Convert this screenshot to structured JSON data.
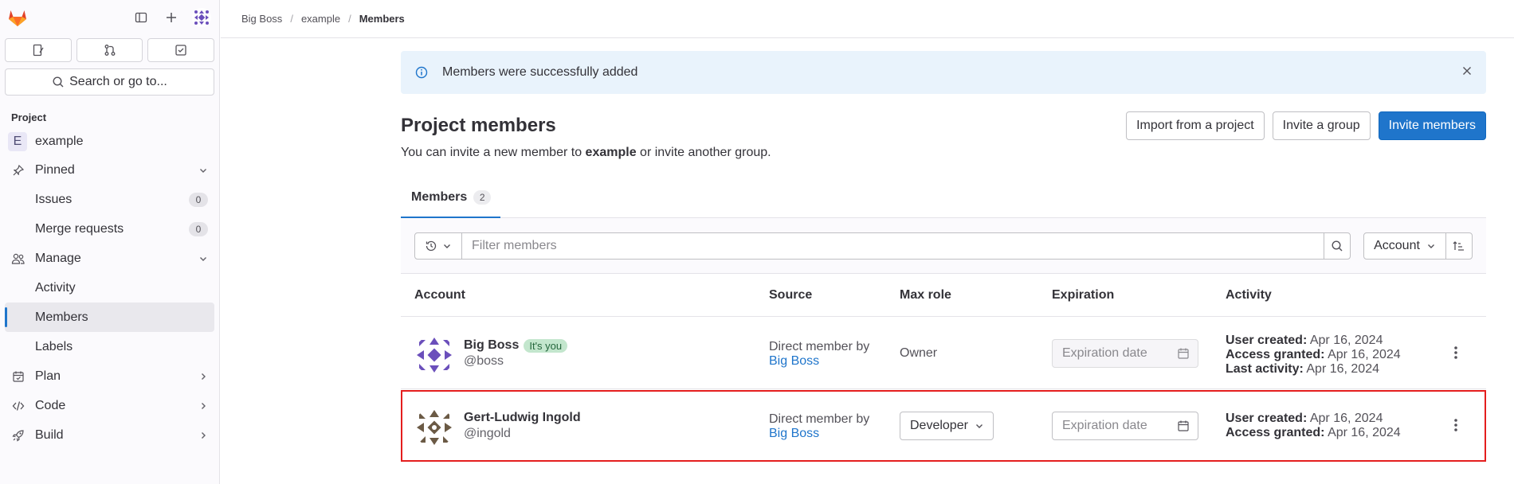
{
  "sidebar": {
    "search_label": "Search or go to...",
    "section_label": "Project",
    "project": {
      "initial": "E",
      "name": "example"
    },
    "pinned": {
      "label": "Pinned",
      "items": [
        {
          "label": "Issues",
          "count": "0"
        },
        {
          "label": "Merge requests",
          "count": "0"
        }
      ]
    },
    "manage": {
      "label": "Manage",
      "items": [
        {
          "label": "Activity"
        },
        {
          "label": "Members"
        },
        {
          "label": "Labels"
        }
      ]
    },
    "plan": "Plan",
    "code": "Code",
    "build": "Build"
  },
  "breadcrumb": [
    "Big Boss",
    "example",
    "Members"
  ],
  "alert": {
    "message": "Members were successfully added"
  },
  "page": {
    "title": "Project members",
    "subtitle_pre": "You can invite a new member to ",
    "subtitle_bold": "example",
    "subtitle_post": " or invite another group.",
    "buttons": {
      "import": "Import from a project",
      "invite_group": "Invite a group",
      "invite_members": "Invite members"
    }
  },
  "tabs": [
    {
      "label": "Members",
      "count": "2"
    }
  ],
  "filter": {
    "placeholder": "Filter members",
    "sort_label": "Account"
  },
  "table": {
    "headers": [
      "Account",
      "Source",
      "Max role",
      "Expiration",
      "Activity"
    ],
    "rows": [
      {
        "name": "Big Boss",
        "badge": "It's you",
        "handle": "@boss",
        "source_text": "Direct member by",
        "source_link": "Big Boss",
        "role": "Owner",
        "expiration_placeholder": "Expiration date",
        "activity": [
          {
            "label": "User created:",
            "value": "Apr 16, 2024"
          },
          {
            "label": "Access granted:",
            "value": "Apr 16, 2024"
          },
          {
            "label": "Last activity:",
            "value": "Apr 16, 2024"
          }
        ]
      },
      {
        "name": "Gert-Ludwig Ingold",
        "handle": "@ingold",
        "source_text": "Direct member by",
        "source_link": "Big Boss",
        "role": "Developer",
        "expiration_placeholder": "Expiration date",
        "activity": [
          {
            "label": "User created:",
            "value": "Apr 16, 2024"
          },
          {
            "label": "Access granted:",
            "value": "Apr 16, 2024"
          }
        ]
      }
    ]
  },
  "colors": {
    "primary": "#1f75cb",
    "alert_bg": "#e9f3fc",
    "highlight": "#e41e1e",
    "badge_green": "#c3e6cd"
  }
}
